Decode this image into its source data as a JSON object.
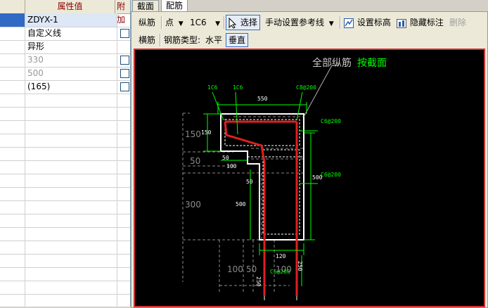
{
  "property_grid": {
    "header": {
      "col1": "属性值",
      "col2": "附加"
    },
    "rows": [
      {
        "value": "ZDYX-1",
        "checkbox": false,
        "selected": true,
        "gray": false
      },
      {
        "value": "自定义线",
        "checkbox": true,
        "selected": false,
        "gray": false
      },
      {
        "value": "异形",
        "checkbox": false,
        "selected": false,
        "gray": false
      },
      {
        "value": "330",
        "checkbox": true,
        "selected": false,
        "gray": true
      },
      {
        "value": "500",
        "checkbox": true,
        "selected": false,
        "gray": true
      },
      {
        "value": "(165)",
        "checkbox": true,
        "selected": false,
        "gray": false
      }
    ]
  },
  "tabs": {
    "section": "截面",
    "rebar": "配筋"
  },
  "toolbar1": {
    "longitudinal_label": "纵筋",
    "mode_select": "点",
    "spec_select": "1C6",
    "select_label": "选择",
    "manual_ref_line": "手动设置参考线",
    "set_elevation": "设置标高",
    "hide_annotations": "隐藏标注",
    "delete_label": "删除"
  },
  "toolbar2": {
    "transverse_label": "横筋",
    "rebar_type_label": "钢筋类型:",
    "horizontal_label": "水平",
    "vertical_label": "垂直"
  },
  "drawing": {
    "callout_all_rebar": "全部纵筋",
    "callout_by_section": "按截面",
    "labels": {
      "rebar_1c6_a": "1C6",
      "rebar_1c6_b": "1C6",
      "stirrup_top": "C8@200",
      "stirrup_right_1": "C6@200",
      "stirrup_right_2": "C6@200",
      "stirrup_bottom": "C6@200",
      "dim_550": "550",
      "dim_150_small": "150",
      "dim_50_a": "50",
      "dim_100_small": "100",
      "dim_50_b": "50",
      "dim_500_a": "500",
      "dim_500_b": "500",
      "dim_120": "120",
      "dim_250_small": "250",
      "dim_250_right": "250",
      "ref_150": "150",
      "ref_50": "50",
      "ref_300": "300",
      "ref_100": "100",
      "ref_50_bottom": "50",
      "ref_100_bottom": "100"
    },
    "colors": {
      "rebar": "#e02020",
      "outline": "#ffffff",
      "dimension": "#00ff00",
      "reference": "#8a8a8a",
      "callout_highlight": "#00ff00"
    }
  }
}
